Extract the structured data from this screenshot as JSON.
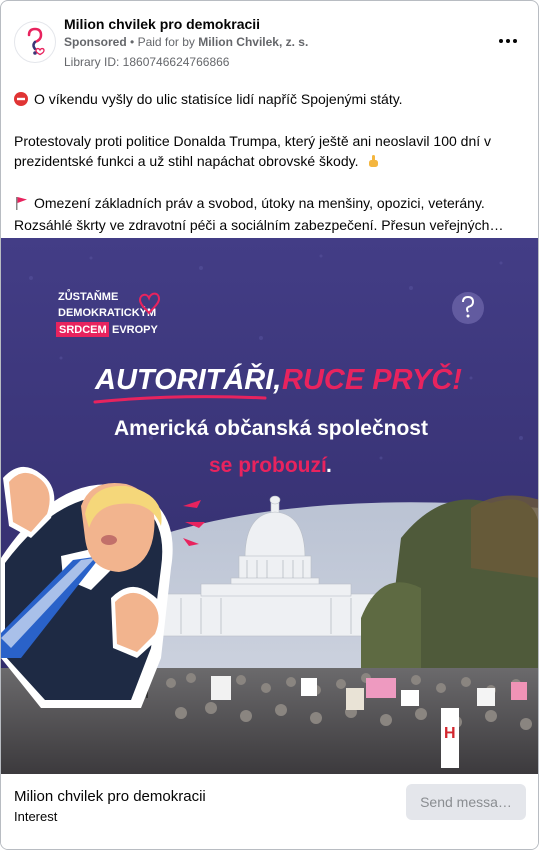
{
  "post": {
    "page_name": "Milion chvilek pro demokracii",
    "sponsored": "Sponsored",
    "paid_for_by": "Paid for by",
    "payer": "Milion Chvilek, z. s.",
    "separator": "•",
    "library_id": "Library ID: 1860746624766866",
    "paragraphs": [
      "O víkendu vyšly do ulic statisíce lidí napříč Spojenými státy.",
      "Protestovaly proti politice Donalda Trumpa, který ještě ani neoslavil 100 dní v prezidentské funkci a už stihl napáchat obrovské škody.",
      "Omezení základních práv a svobod, útoky na menšiny, opozici, veterány. Rozsáhlé škrty ve zdravotní péči a sociálním zabezpečení. Přesun veřejných peně…"
    ],
    "emojis": {
      "stop": "no-entry-icon",
      "point": "pointing-hand-icon",
      "flag": "red-flag-icon"
    }
  },
  "creative": {
    "logo_lines": [
      "ZŮSTAŇME",
      "DEMOKRATICKÝM",
      "SRDCEM",
      "EVROPY"
    ],
    "headline_white": "AUTORITÁŘI,",
    "headline_red": "RUCE PRYČ!",
    "subline": "Americká občanská společnost",
    "subline_red": "se probouzí",
    "subline_end": ".",
    "colors": {
      "background": "#3b3677",
      "accent": "#e8235e",
      "white": "#ffffff"
    }
  },
  "footer": {
    "title": "Milion chvilek pro demokracii",
    "subtitle": "Interest",
    "cta": "Send messa…"
  }
}
